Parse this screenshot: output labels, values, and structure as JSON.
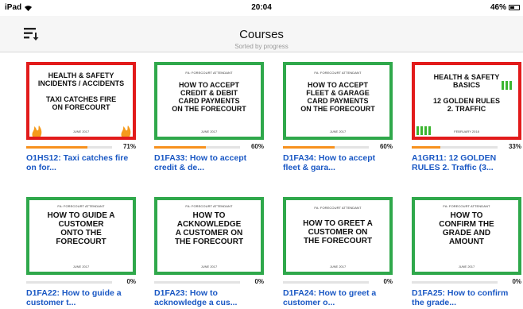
{
  "status_bar": {
    "device": "iPad",
    "time": "20:04",
    "battery": "46%"
  },
  "header": {
    "title": "Courses",
    "subtitle": "Sorted by progress",
    "sort_icon": "sort-icon"
  },
  "colors": {
    "link_blue": "#1a58c4",
    "progress_orange": "#f7911d",
    "border_green": "#2fa84b",
    "border_red": "#e21b1b"
  },
  "courses": [
    {
      "thumb_title": "HEALTH & SAFETY\nINCIDENTS / ACCIDENTS\n\nTAXI CATCHES FIRE\nON FORECOURT",
      "thumb_date": "JUNE 2017",
      "progress": 71,
      "progress_label": "71%",
      "label": "O1HS12: Taxi catches fire on for..."
    },
    {
      "thumb_category": "FA: FORECOURT ATTENDANT",
      "thumb_title": "HOW TO ACCEPT\nCREDIT & DEBIT\nCARD PAYMENTS\nON THE FORECOURT",
      "thumb_date": "JUNE 2017",
      "progress": 60,
      "progress_label": "60%",
      "label": "D1FA33: How to accept credit & de..."
    },
    {
      "thumb_category": "FA: FORECOURT ATTENDANT",
      "thumb_title": "HOW TO ACCEPT\nFLEET & GARAGE\nCARD PAYMENTS\nON THE FORECOURT",
      "thumb_date": "JUNE 2017",
      "progress": 60,
      "progress_label": "60%",
      "label": "D1FA34: How to accept fleet & gara..."
    },
    {
      "thumb_title": "HEALTH & SAFETY\nBASICS\n\n12 GOLDEN RULES\n2. TRAFFIC",
      "thumb_date": "FEBRUARY 2018",
      "progress": 33,
      "progress_label": "33%",
      "label": "A1GR11: 12 GOLDEN RULES 2. Traffic (3..."
    },
    {
      "thumb_category": "FA: FORECOURT ATTENDANT",
      "thumb_title": "HOW TO GUIDE A\nCUSTOMER\nONTO THE\nFORECOURT",
      "thumb_date": "JUNE 2017",
      "progress": 0,
      "progress_label": "0%",
      "label": "D1FA22: How to guide a customer t..."
    },
    {
      "thumb_category": "FA: FORECOURT ATTENDANT",
      "thumb_title": "HOW TO\nACKNOWLEDGE\nA CUSTOMER ON\nTHE FORECOURT",
      "thumb_date": "JUNE 2017",
      "progress": 0,
      "progress_label": "0%",
      "label": "D1FA23: How to acknowledge a cus..."
    },
    {
      "thumb_category": "FA: FORECOURT ATTENDANT",
      "thumb_title": "HOW TO GREET A\nCUSTOMER ON\nTHE FORECOURT",
      "thumb_date": "JUNE 2017",
      "progress": 0,
      "progress_label": "0%",
      "label": "D1FA24: How to greet a customer o..."
    },
    {
      "thumb_category": "FA: FORECOURT ATTENDANT",
      "thumb_title": "HOW TO\nCONFIRM THE\nGRADE AND\nAMOUNT",
      "thumb_date": "JUNE 2017",
      "progress": 0,
      "progress_label": "0%",
      "label": "D1FA25: How to confirm the grade..."
    }
  ]
}
